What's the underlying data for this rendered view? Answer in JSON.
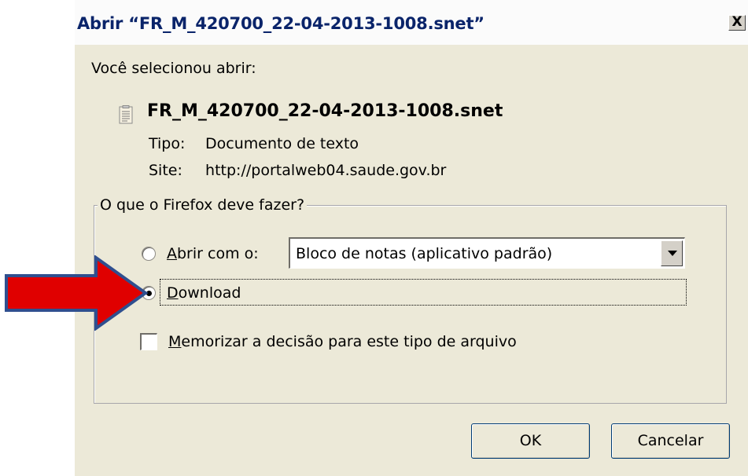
{
  "dialog": {
    "title": "Abrir “FR_M_420700_22-04-2013-1008.snet”",
    "close_label": "X",
    "intro": "Você selecionou abrir:",
    "file_name": "FR_M_420700_22-04-2013-1008.snet",
    "file_icon": "text-file-icon",
    "type_label": "Tipo:",
    "type_value": "Documento de texto",
    "site_label": "Site:",
    "site_value": "http://portalweb04.saude.gov.br"
  },
  "action": {
    "legend": "O que o Firefox deve fazer?",
    "open_with_label": "Abrir com o:",
    "open_with_app": "Bloco de notas (aplicativo padrão)",
    "download_label": "Download",
    "selected": "download",
    "remember_label": "Memorizar a decisão para este tipo de arquivo",
    "remember_checked": false
  },
  "buttons": {
    "ok": "OK",
    "cancel": "Cancelar"
  },
  "annotation": {
    "arrow_color": "#e00000",
    "arrow_outline": "#2f4f8f"
  }
}
